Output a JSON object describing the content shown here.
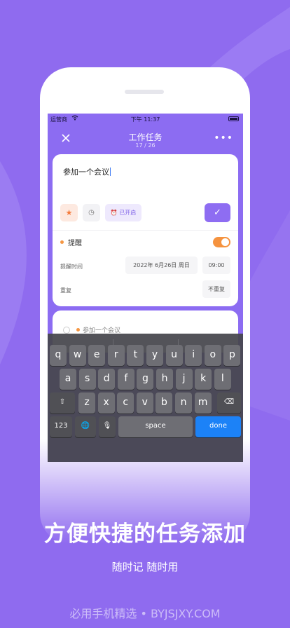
{
  "status_bar": {
    "carrier": "运营商",
    "time": "下午 11:37"
  },
  "nav": {
    "title": "工作任务",
    "counter": "17 / 26",
    "close_icon": "close-icon",
    "more_icon": "more-icon"
  },
  "task": {
    "title": "参加一个会议",
    "alarm_chip": "已开启",
    "remind_label": "提醒",
    "remind_enabled": true,
    "remind_time_label": "提醒时间",
    "date_value": "2022年 6月26日 周日",
    "time_value": "09:00",
    "repeat_label": "重复",
    "repeat_value": "不重复"
  },
  "next_task": {
    "title": "参加一个会议"
  },
  "keyboard": {
    "row1": [
      "q",
      "w",
      "e",
      "r",
      "t",
      "y",
      "u",
      "i",
      "o",
      "p"
    ],
    "row2": [
      "a",
      "s",
      "d",
      "f",
      "g",
      "h",
      "j",
      "k",
      "l"
    ],
    "row3": [
      "z",
      "x",
      "c",
      "v",
      "b",
      "n",
      "m"
    ],
    "numbers_label": "123",
    "space_label": "space",
    "done_label": "done"
  },
  "promo": {
    "headline": "方便快捷的任务添加",
    "subline": "随时记 随时用",
    "watermark": "必用手机精选 • BYJSJXY.COM"
  },
  "colors": {
    "accent": "#8e6df2",
    "background": "#8f6bef",
    "toggle_on": "#f5933f",
    "done_key": "#1c82f7"
  }
}
